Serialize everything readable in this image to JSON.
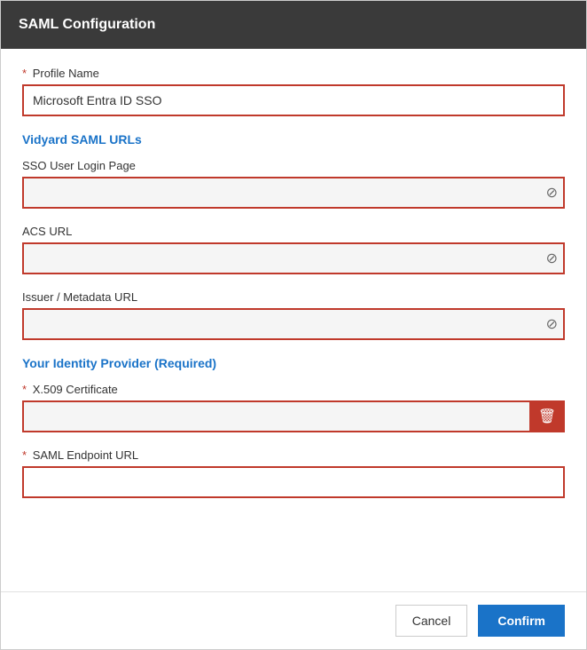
{
  "header": {
    "title": "SAML Configuration"
  },
  "form": {
    "profile_name_label": "Profile Name",
    "profile_name_value": "Microsoft Entra ID SSO",
    "profile_name_placeholder": "",
    "vidyard_section_heading": "Vidyard SAML URLs",
    "sso_login_label": "SSO User Login Page",
    "sso_login_value": "",
    "sso_login_placeholder": "",
    "acs_url_label": "ACS URL",
    "acs_url_value": "",
    "acs_url_placeholder": "",
    "issuer_label": "Issuer / Metadata URL",
    "issuer_value": "",
    "issuer_placeholder": "",
    "identity_section_heading": "Your Identity Provider (Required)",
    "certificate_label": "X.509 Certificate",
    "certificate_value": "",
    "certificate_placeholder": "",
    "saml_endpoint_label": "SAML Endpoint URL",
    "saml_endpoint_value": "",
    "saml_endpoint_placeholder": ""
  },
  "footer": {
    "cancel_label": "Cancel",
    "confirm_label": "Confirm"
  },
  "icons": {
    "no_symbol": "⊘",
    "delete": "🗑"
  }
}
